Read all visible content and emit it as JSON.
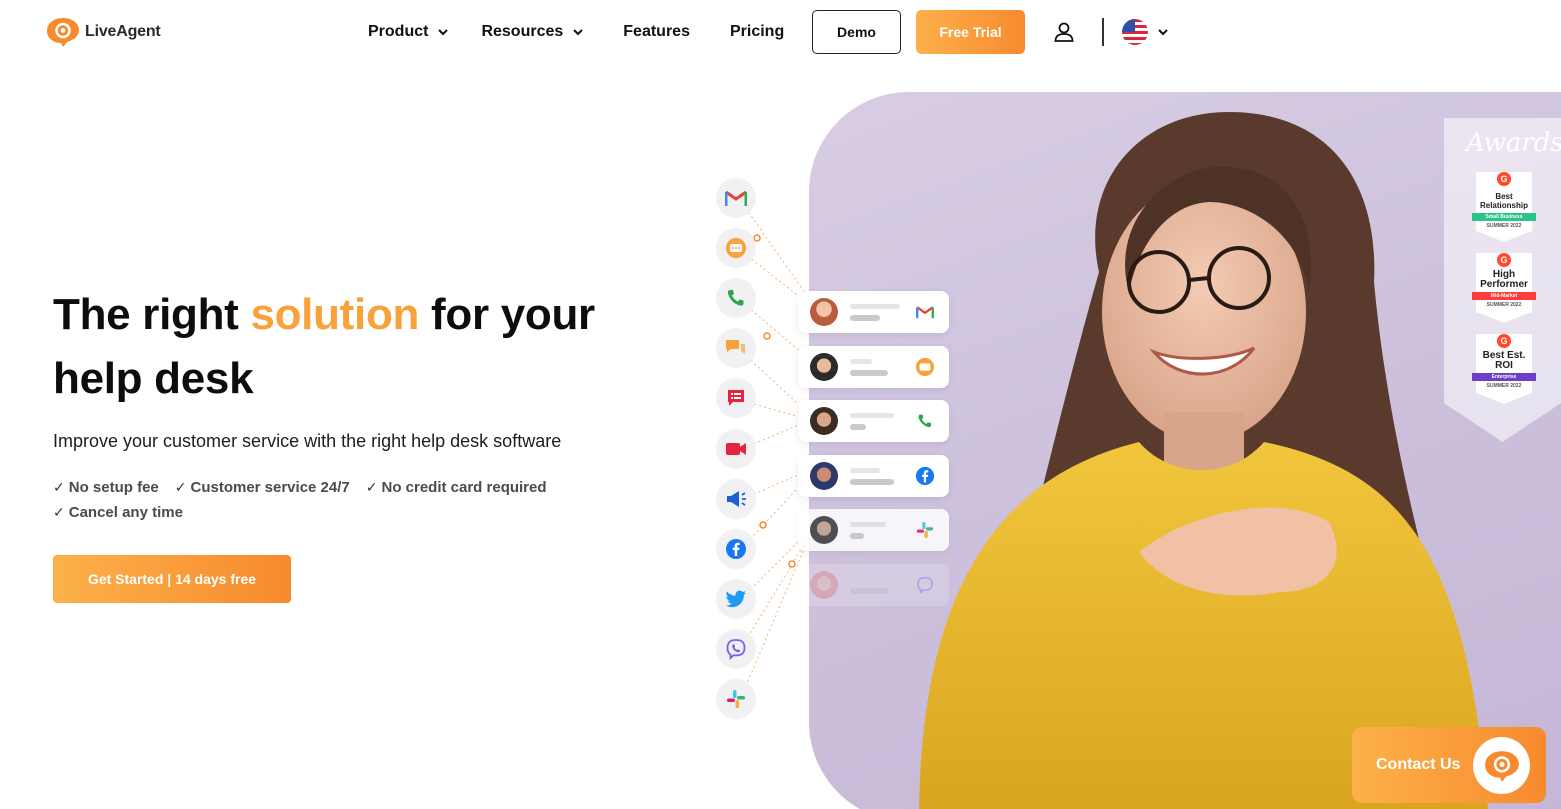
{
  "brand": {
    "name": "LiveAgent",
    "color": "#f7a23a",
    "accent": "#f78a2e"
  },
  "nav": {
    "items": [
      {
        "label": "Product",
        "has_dropdown": true
      },
      {
        "label": "Resources",
        "has_dropdown": true
      },
      {
        "label": "Features",
        "has_dropdown": false
      },
      {
        "label": "Pricing",
        "has_dropdown": false
      }
    ],
    "demo_label": "Demo",
    "trial_label": "Free Trial",
    "user_icon": "user-icon",
    "language_icon": "us-flag-icon"
  },
  "hero": {
    "title_before": "The right ",
    "title_accent": "solution",
    "title_after": " for your help desk",
    "subtitle": "Improve your customer service with the right help desk software",
    "checks": [
      "No setup fee",
      "Customer service 24/7",
      "No credit card required",
      "Cancel any time"
    ],
    "cta_label": "Get Started | 14 days free"
  },
  "channels": [
    "gmail-icon",
    "chat-icon",
    "phone-icon",
    "messages-icon",
    "forms-icon",
    "video-icon",
    "megaphone-icon",
    "facebook-icon",
    "twitter-icon",
    "viber-icon",
    "slack-icon"
  ],
  "tickets": [
    {
      "channel": "gmail-icon"
    },
    {
      "channel": "chat-icon"
    },
    {
      "channel": "phone-icon"
    },
    {
      "channel": "facebook-icon"
    },
    {
      "channel": "slack-icon"
    },
    {
      "channel": "viber-icon"
    }
  ],
  "awards": {
    "title": "Awards",
    "badges": [
      {
        "title": "Best Relationship",
        "ribbon": "Small Business",
        "ribbon_color": "#2bc48a",
        "season": "SUMMER 2022"
      },
      {
        "title": "High Performer",
        "ribbon": "Mid-Market",
        "ribbon_color": "#ff3b3b",
        "season": "SUMMER 2022"
      },
      {
        "title": "Best Est. ROI",
        "ribbon": "Enterprise",
        "ribbon_color": "#6b3fc8",
        "season": "SUMMER 2022"
      }
    ]
  },
  "contact": {
    "label": "Contact Us"
  }
}
